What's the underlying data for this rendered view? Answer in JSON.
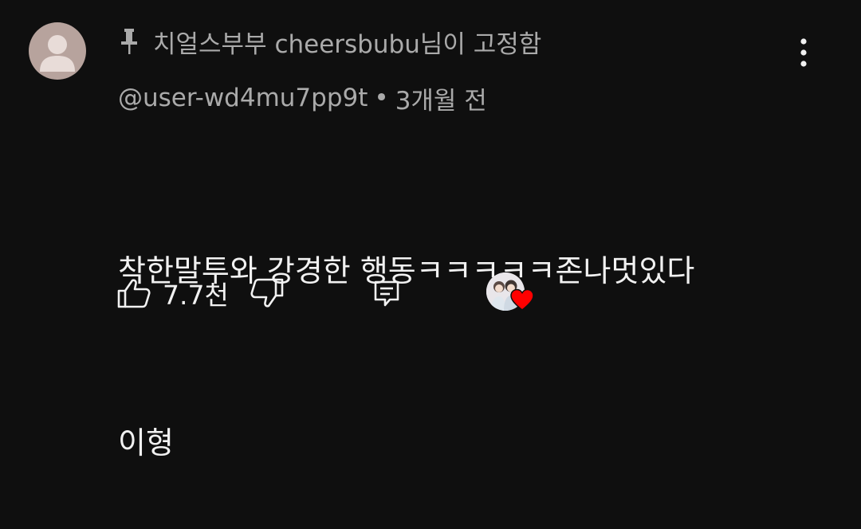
{
  "comment": {
    "pinned_label": "치얼스부부 cheersbubu님이 고정함",
    "author": "@user-wd4mu7pp9t",
    "separator": "•",
    "time": "3개월 전",
    "text_line1": "착한말투와 강경한 행동ㅋㅋㅋㅋㅋ존나멋있다",
    "text_line2": "이형",
    "likes": "7.7천"
  },
  "icons": {
    "pin": "pin-icon",
    "more": "more-vertical-icon",
    "like": "thumbs-up-icon",
    "dislike": "thumbs-down-icon",
    "reply": "reply-icon",
    "creator_heart": "heart-icon"
  },
  "colors": {
    "background": "#0f0f0f",
    "primary_text": "#f1f1f1",
    "secondary_text": "#aaaaaa",
    "heart": "#ff0000",
    "avatar": "#b7a39d"
  }
}
